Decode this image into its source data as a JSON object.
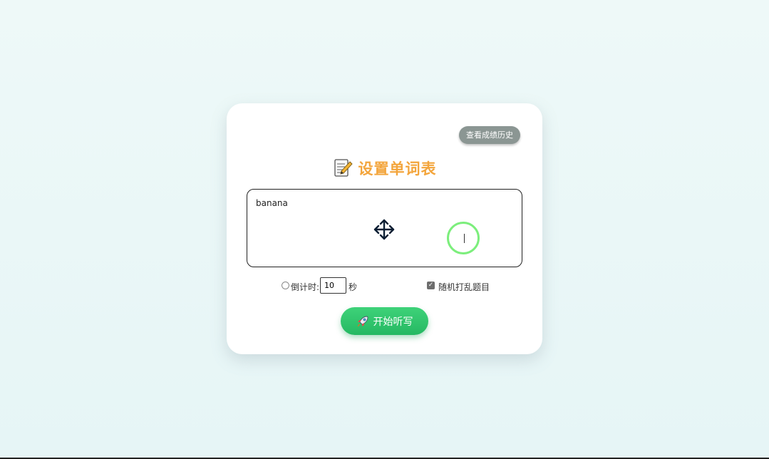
{
  "header": {
    "history_label": "查看成绩历史",
    "title": "设置单词表",
    "title_icon": "memo-icon"
  },
  "word_list": {
    "value": "banana"
  },
  "options": {
    "timer_label": "倒计时:",
    "timer_value": "10",
    "timer_unit": "秒",
    "timer_checked": false,
    "random_label": "随机打乱题目",
    "random_checked": true
  },
  "actions": {
    "start_label": "开始听写",
    "start_icon": "rocket-icon"
  },
  "colors": {
    "title": "#f3a53c",
    "start_button": "#2ec46b",
    "history_button": "#8b9693",
    "cursor_ring": "#7cee7c"
  }
}
